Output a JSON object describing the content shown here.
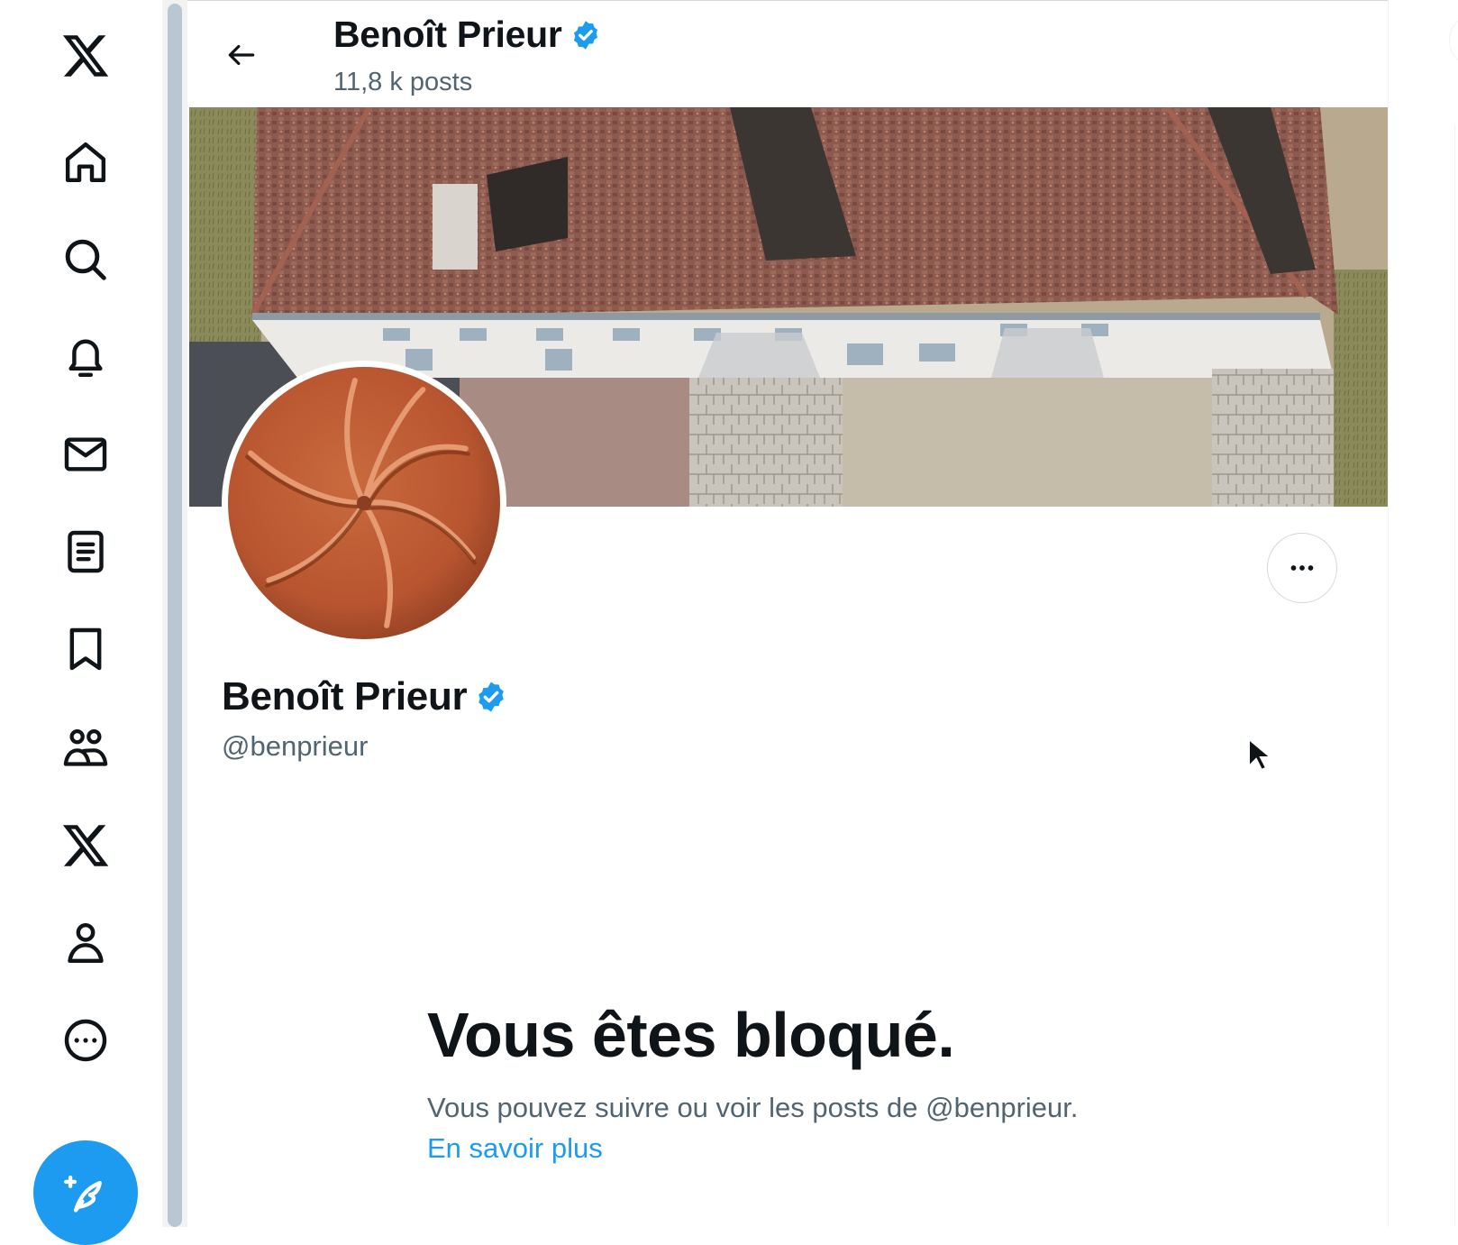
{
  "nav": {
    "items": [
      {
        "name": "x-logo-icon"
      },
      {
        "name": "home-icon"
      },
      {
        "name": "search-icon"
      },
      {
        "name": "notifications-bell-icon"
      },
      {
        "name": "messages-envelope-icon"
      },
      {
        "name": "lists-icon"
      },
      {
        "name": "bookmark-icon"
      },
      {
        "name": "communities-icon"
      },
      {
        "name": "premium-x-icon"
      },
      {
        "name": "profile-icon"
      },
      {
        "name": "more-circle-icon"
      }
    ],
    "compose_icon": "compose-quill-icon"
  },
  "header": {
    "name": "Benoît Prieur",
    "posts": "11,8 k posts"
  },
  "profile": {
    "name": "Benoît Prieur",
    "handle": "@benprieur"
  },
  "blocked": {
    "title": "Vous êtes bloqué.",
    "message": "Vous pouvez suivre ou voir les posts de @benprieur.",
    "link": "En savoir plus"
  },
  "colors": {
    "accent": "#1d9bf0",
    "text_primary": "#0f1419",
    "text_secondary": "#536471"
  }
}
